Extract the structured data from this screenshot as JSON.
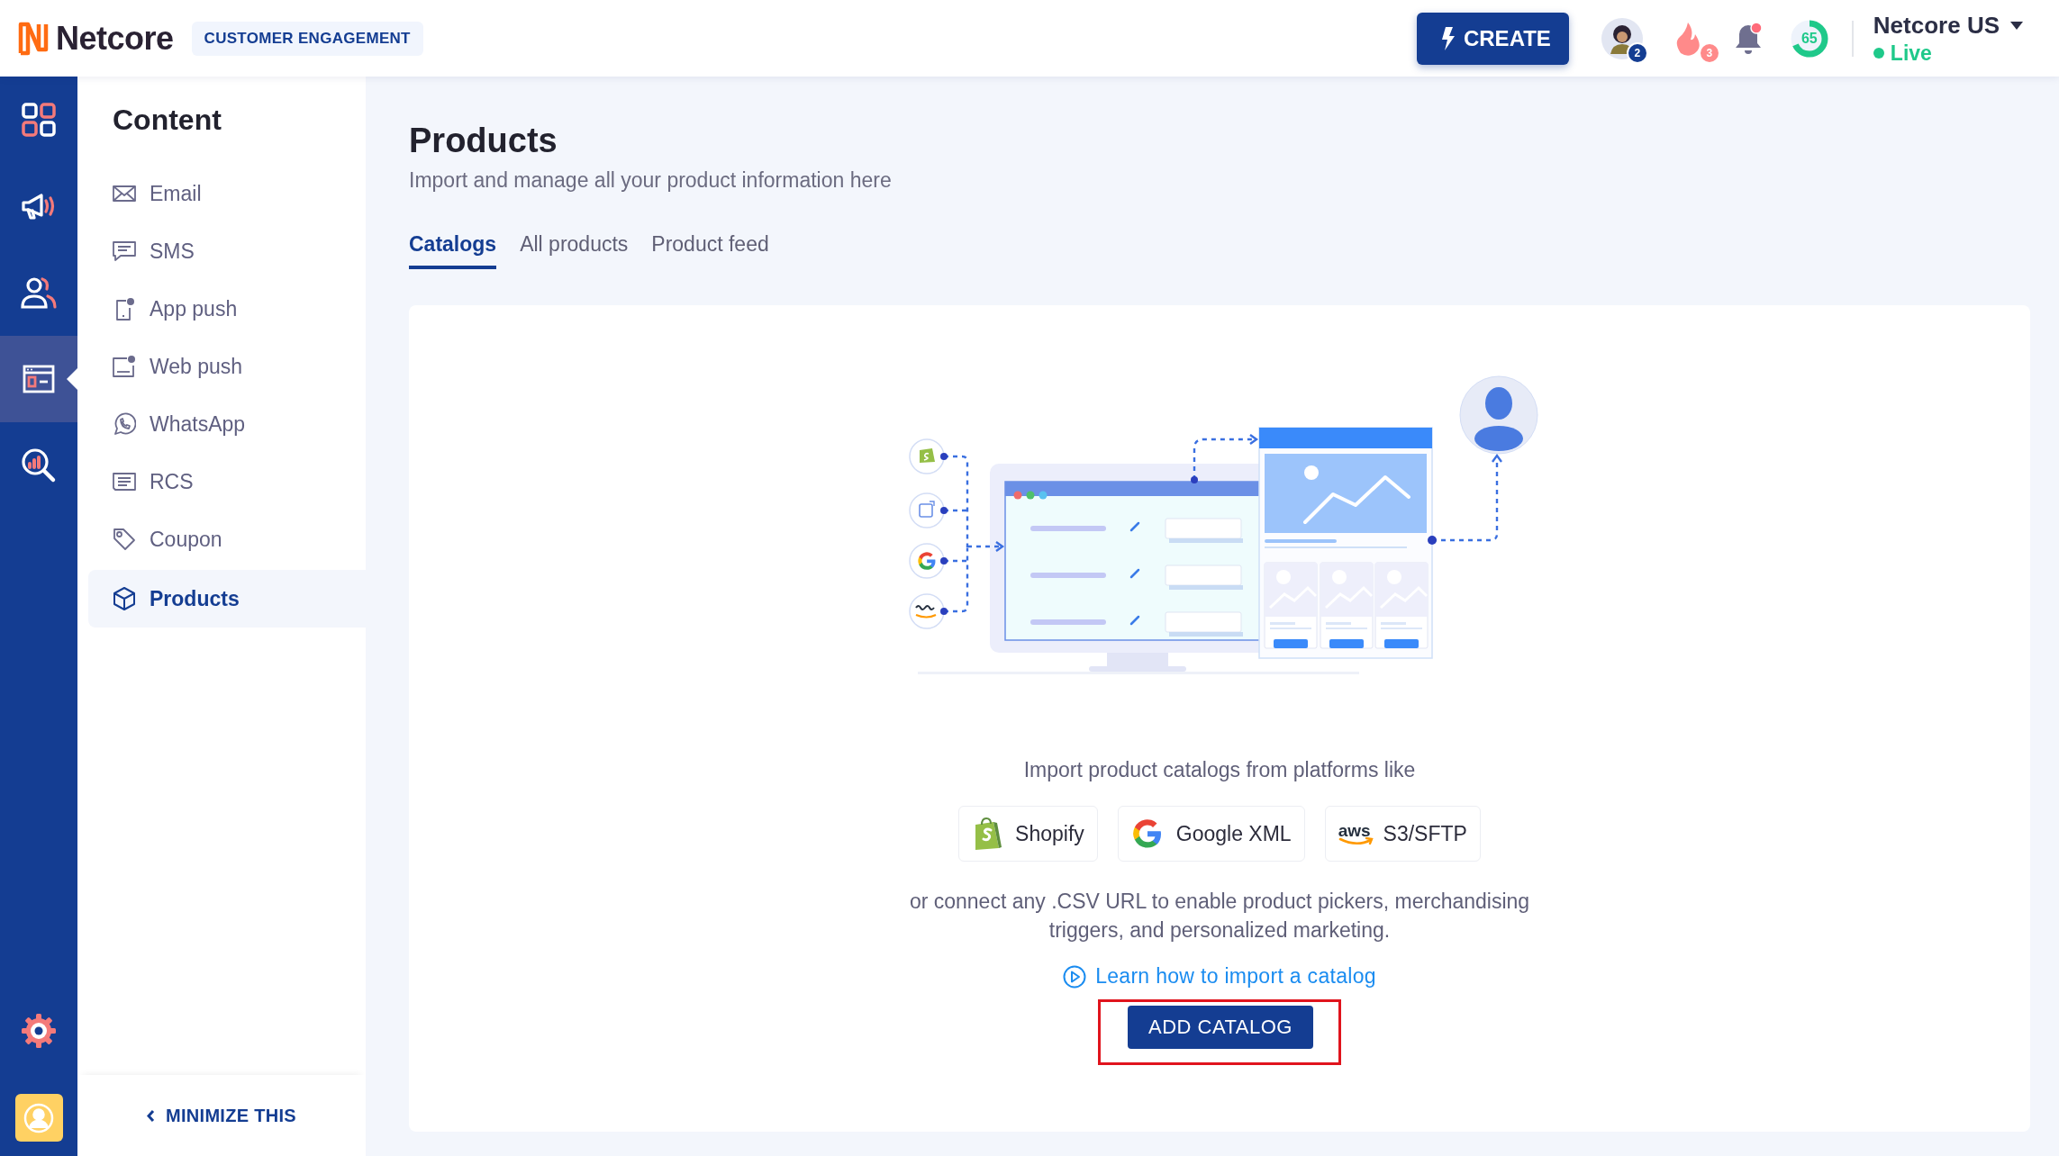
{
  "header": {
    "logo": "Netcore",
    "product_badge": "CUSTOMER ENGAGEMENT",
    "create_button": "CREATE",
    "avatar_count": "2",
    "streak_count": "3",
    "bell_unread": true,
    "score": {
      "value": "65",
      "level": 0.68
    },
    "account": {
      "name": "Netcore US",
      "status": "Live"
    }
  },
  "rail": [
    {
      "kind": "dashboard",
      "selected": false
    },
    {
      "kind": "campaigns",
      "selected": false
    },
    {
      "kind": "audience",
      "selected": false
    },
    {
      "kind": "content",
      "selected": true
    },
    {
      "kind": "analytics",
      "selected": false
    },
    {
      "kind": "settings",
      "selected": false
    },
    {
      "kind": "profile",
      "selected": false
    }
  ],
  "sidebar": {
    "title": "Content",
    "items": [
      {
        "kind": "email",
        "label": "Email",
        "selected": false
      },
      {
        "kind": "sms",
        "label": "SMS",
        "selected": false
      },
      {
        "kind": "app_push",
        "label": "App push",
        "selected": false
      },
      {
        "kind": "web_push",
        "label": "Web push",
        "selected": false
      },
      {
        "kind": "whatsapp",
        "label": "WhatsApp",
        "selected": false
      },
      {
        "kind": "rcs",
        "label": "RCS",
        "selected": false
      },
      {
        "kind": "coupon",
        "label": "Coupon",
        "selected": false
      },
      {
        "kind": "products",
        "label": "Products",
        "selected": true
      }
    ],
    "minimize": "MINIMIZE THIS"
  },
  "page": {
    "title": "Products",
    "subtitle": "Import and manage all your product information here",
    "tabs": [
      {
        "label": "Catalogs",
        "selected": true
      },
      {
        "label": "All products",
        "selected": false
      },
      {
        "label": "Product feed",
        "selected": false
      }
    ],
    "empty_state": {
      "intro": "Import product catalogs from platforms like",
      "platforms": [
        {
          "kind": "shopify",
          "label": "Shopify"
        },
        {
          "kind": "google",
          "label": "Google XML"
        },
        {
          "kind": "aws",
          "label": "S3/SFTP",
          "logo_text": "aws"
        }
      ],
      "description": "or connect any .CSV URL to enable product pickers, merchandising triggers, and personalized marketing.",
      "help_link": "Learn how to import a catalog",
      "add_button": "ADD CATALOG",
      "add_button_highlighted": true
    }
  }
}
